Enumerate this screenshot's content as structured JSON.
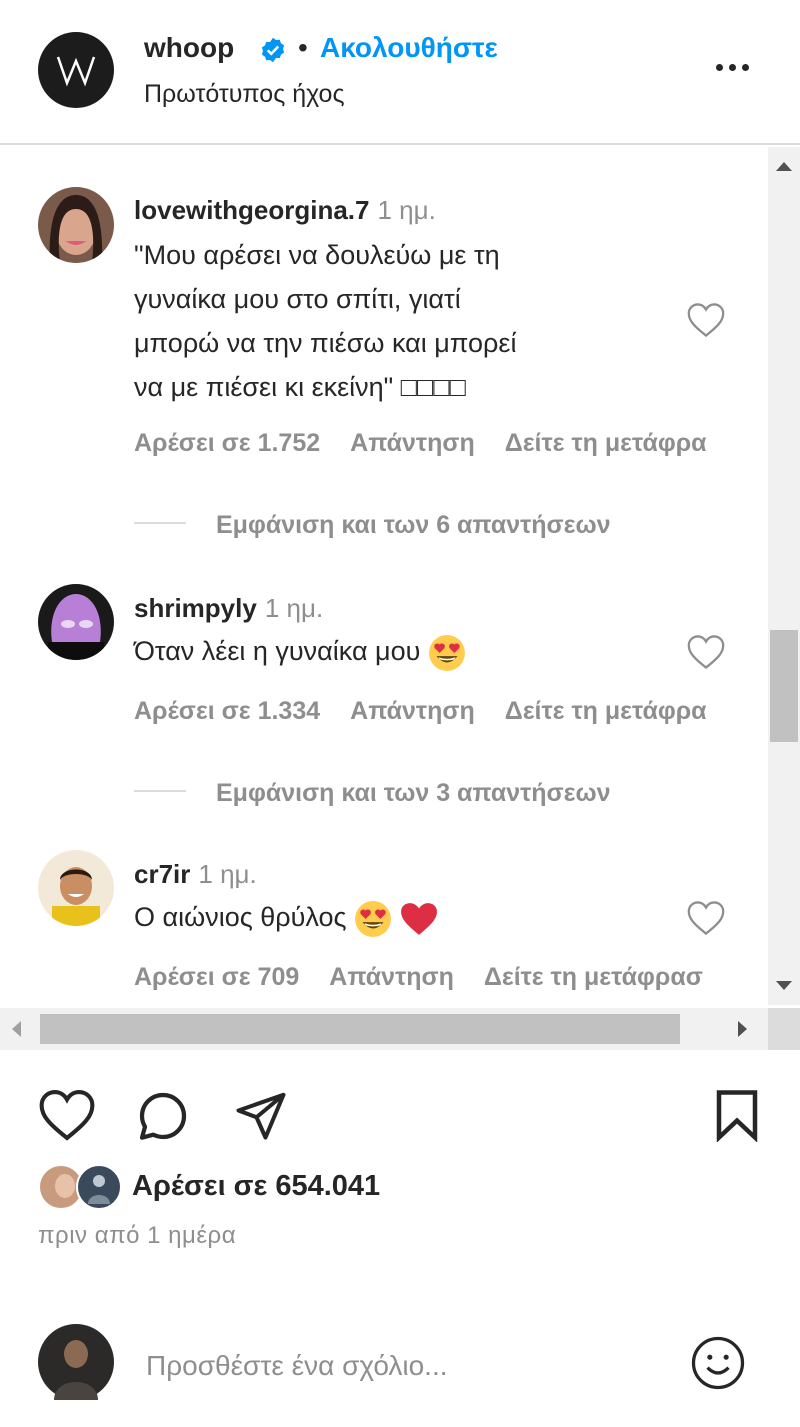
{
  "header": {
    "username": "whoop",
    "separator": "•",
    "follow_label": "Ακολουθήστε",
    "audio_label": "Πρωτότυπος ήχος",
    "logo_text": "W"
  },
  "comments": [
    {
      "username": "lovewithgeorgina.7",
      "time": "1 ημ.",
      "text_lines": [
        "\"Μου αρέσει να δουλεύω με τη",
        "γυναίκα μου στο σπίτι, γιατί",
        "μπορώ να την πιέσω και μπορεί",
        "να με πιέσει κι εκείνη\" □□□□"
      ],
      "likes": "Αρέσει σε 1.752",
      "reply": "Απάντηση",
      "translate": "Δείτε τη μετάφρα",
      "view_replies": "Εμφάνιση και των 6 απαντήσεων"
    },
    {
      "username": "shrimpyly",
      "time": "1 ημ.",
      "text": "Όταν λέει η γυναίκα μου",
      "likes": "Αρέσει σε 1.334",
      "reply": "Απάντηση",
      "translate": "Δείτε τη μετάφρα",
      "view_replies": "Εμφάνιση και των 3 απαντήσεων"
    },
    {
      "username": "cr7ir",
      "time": "1 ημ.",
      "text": "Ο αιώνιος θρύλος",
      "likes": "Αρέσει σε 709",
      "reply": "Απάντηση",
      "translate": "Δείτε τη μετάφρασ"
    }
  ],
  "post": {
    "likes_label": "Αρέσει σε 654.041",
    "time_ago": "πριν από 1 ημέρα"
  },
  "add_comment": {
    "placeholder": "Προσθέστε ένα σχόλιο..."
  },
  "colors": {
    "accent": "#0095f6",
    "text": "#262626",
    "secondary": "#8e8e8e",
    "border": "#dbdbdb"
  },
  "icons": [
    "verified-badge-icon",
    "more-options-icon",
    "heart-icon",
    "comment-icon",
    "share-icon",
    "bookmark-icon",
    "emoji-icon"
  ]
}
